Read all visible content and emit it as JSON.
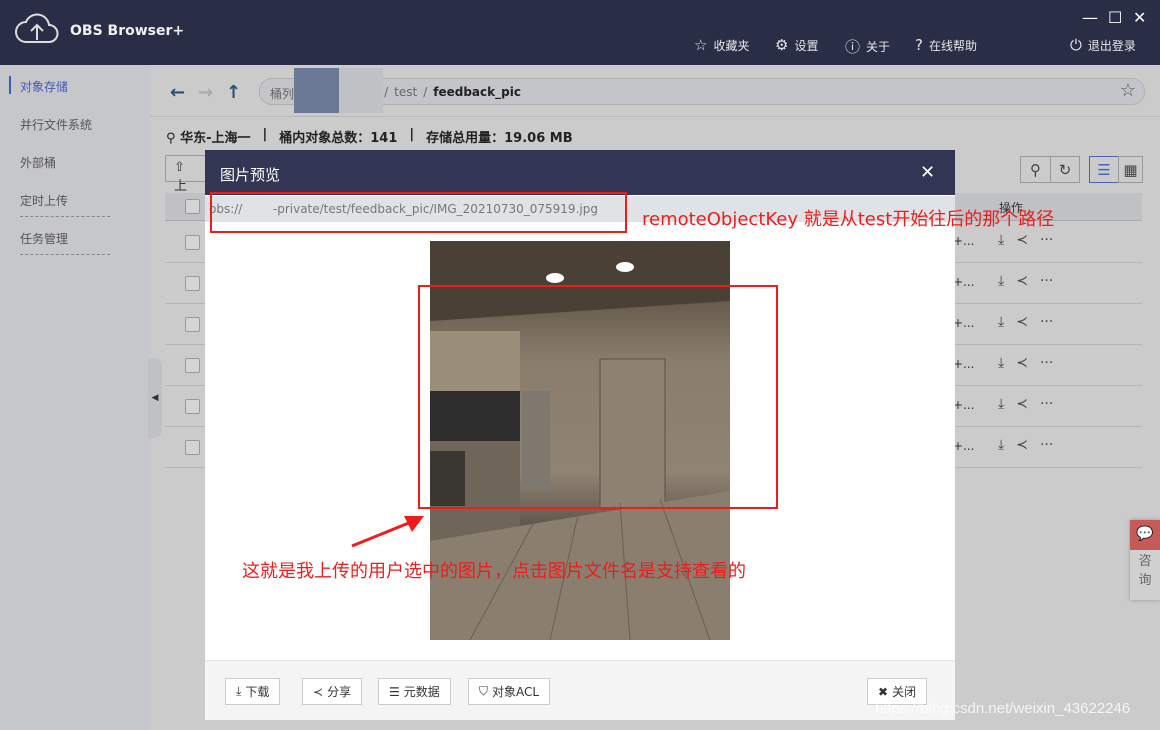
{
  "app": {
    "title": "OBS Browser+",
    "window_controls": [
      "—",
      "☐",
      "✕"
    ]
  },
  "topnav": [
    {
      "icon": "star-icon",
      "glyph": "☆",
      "label": "收藏夹"
    },
    {
      "icon": "gear-icon",
      "glyph": "⚙",
      "label": "设置"
    },
    {
      "icon": "info-icon",
      "glyph": "ⓘ",
      "label": "关于"
    },
    {
      "icon": "help-icon",
      "glyph": "?",
      "label": "在线帮助"
    },
    {
      "icon": "power-icon",
      "glyph": "⏻",
      "label": "退出登录"
    }
  ],
  "sidebar": {
    "items": [
      {
        "label": "对象存储",
        "active": true
      },
      {
        "label": "并行文件系统"
      },
      {
        "label": "外部桶"
      },
      {
        "label": "定时上传"
      },
      {
        "label": "任务管理"
      }
    ]
  },
  "breadcrumb": {
    "root": "桶列",
    "seg1": "te",
    "seg2": "test",
    "current": "feedback_pic"
  },
  "stats": {
    "region": "华东-上海一",
    "objects_label": "桶内对象总数：",
    "objects": "141",
    "usage_label": "存储总用量：",
    "usage": "19.06 MB"
  },
  "toolbar": {
    "upload": "上"
  },
  "table": {
    "ops_header": "操作",
    "rows": [
      {
        "cell": "+..."
      },
      {
        "cell": "+..."
      },
      {
        "cell": "+..."
      },
      {
        "cell": "+..."
      },
      {
        "cell": "+..."
      },
      {
        "cell": "+..."
      }
    ]
  },
  "consult": {
    "label1": "咨",
    "label2": "询"
  },
  "modal": {
    "title": "图片预览",
    "path": "obs://    -private/test/feedback_pic/IMG_20210730_075919.jpg",
    "buttons": {
      "download": "下载",
      "share": "分享",
      "metadata": "元数据",
      "acl": "对象ACL",
      "close": "关闭"
    }
  },
  "annotations": {
    "note1": "remoteObjectKey 就是从test开始往后的那个路径",
    "note2": "这就是我上传的用户选中的图片，点击图片文件名是支持查看的",
    "color": "#f01c1c"
  },
  "watermark": "https://blog.csdn.net/weixin_43622246"
}
